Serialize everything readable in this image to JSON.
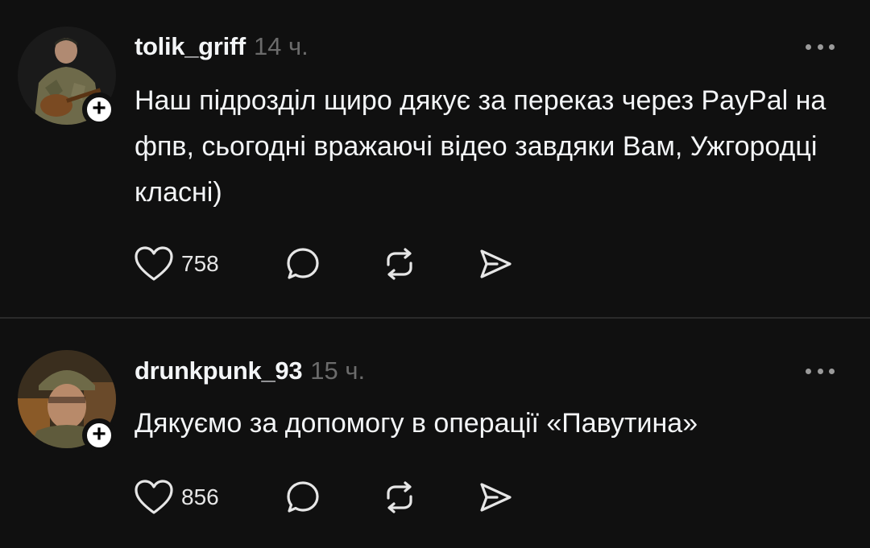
{
  "posts": [
    {
      "username": "tolik_griff",
      "time": "14 ч.",
      "text": "Наш підрозділ щиро дякує за переказ через PayPal на фпв, сьогодні вражаючі відео завдяки Вам, Ужгородці класні)",
      "likes": "758",
      "follow_label": "+"
    },
    {
      "username": "drunkpunk_93",
      "time": "15 ч.",
      "text": "Дякуємо за допомогу в операції «Павутина»",
      "likes": "856",
      "follow_label": "+"
    }
  ],
  "icons": {
    "like": "heart-icon",
    "comment": "comment-icon",
    "repost": "repost-icon",
    "share": "share-icon",
    "more": "more-options-icon"
  },
  "colors": {
    "background": "#101010",
    "text": "#f3f5f7",
    "muted": "#6b6b6b",
    "divider": "#2a2a2a"
  }
}
